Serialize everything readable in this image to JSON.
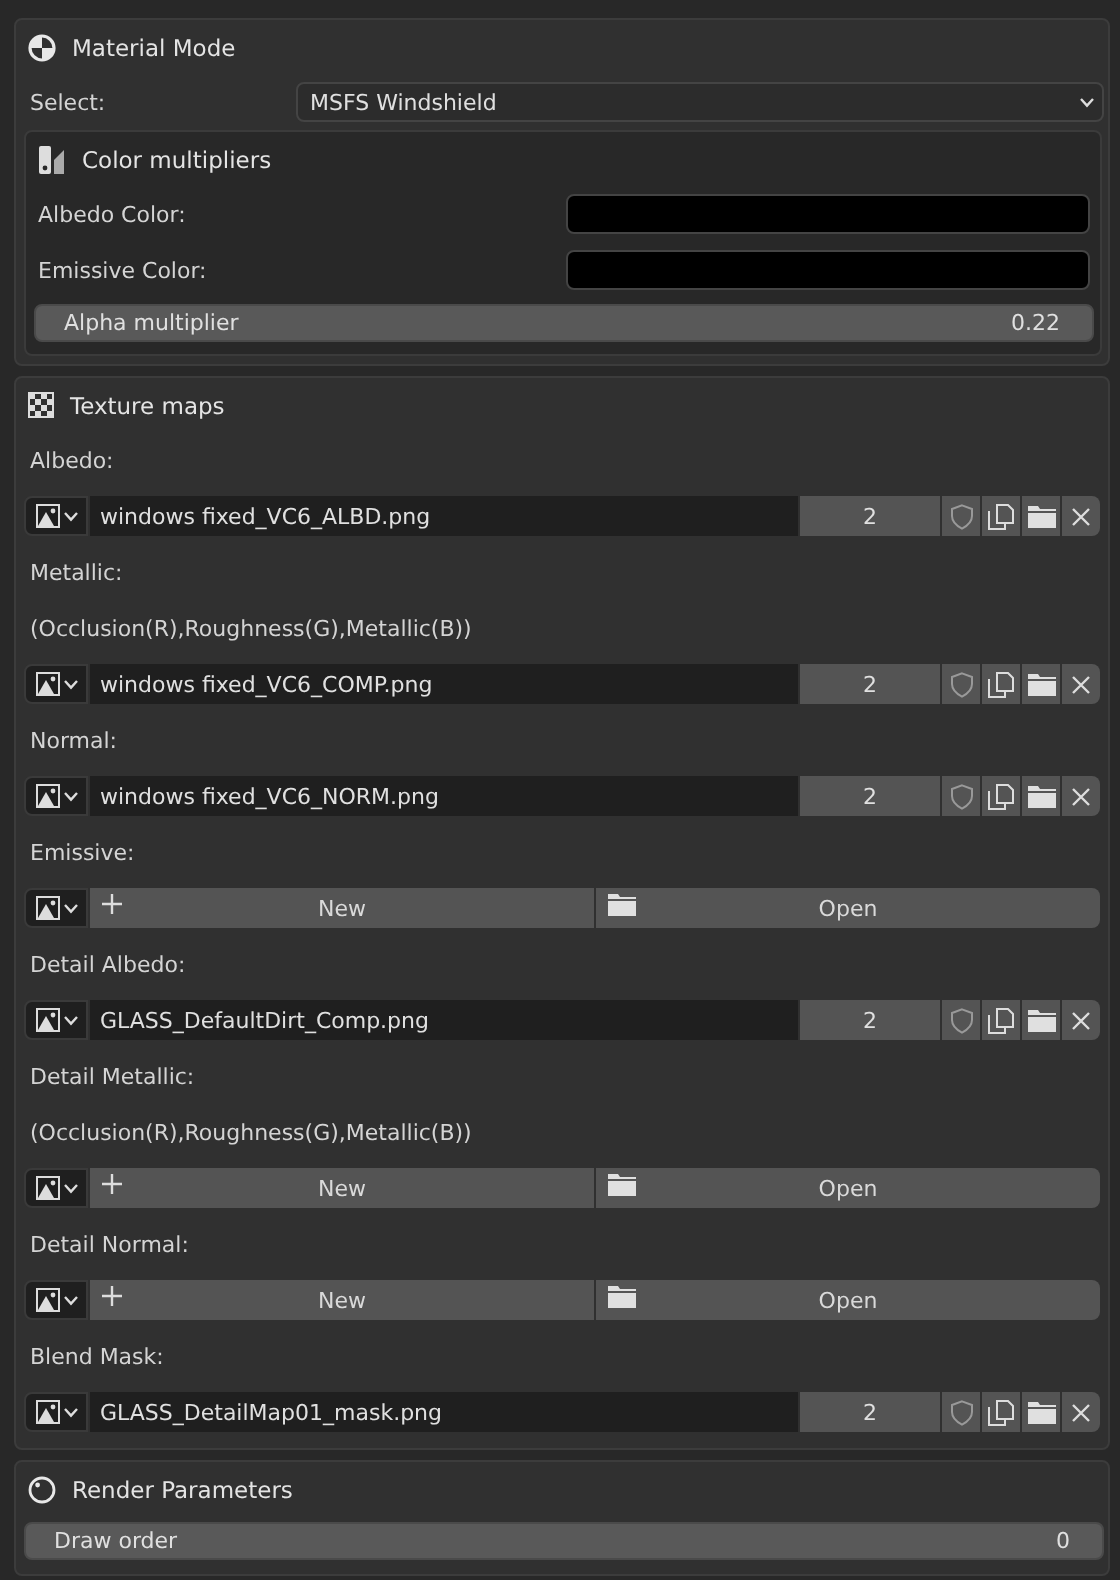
{
  "material_mode": {
    "title": "Material Mode",
    "select_label": "Select:",
    "select_value": "MSFS Windshield",
    "color_multipliers": {
      "title": "Color multipliers",
      "colors": [
        {
          "label": "Albedo Color:",
          "color": "#000000"
        },
        {
          "label": "Emissive Color:",
          "color": "#000000"
        }
      ],
      "alpha": {
        "label": "Alpha multiplier",
        "value": "0.22"
      }
    }
  },
  "texture_maps": {
    "title": "Texture maps",
    "items": [
      {
        "kind": "label",
        "text": "Albedo:"
      },
      {
        "kind": "file",
        "filename": "windows fixed_VC6_ALBD.png",
        "users": "2"
      },
      {
        "kind": "label",
        "text": "Metallic:"
      },
      {
        "kind": "label",
        "text": "(Occlusion(R),Roughness(G),Metallic(B))"
      },
      {
        "kind": "file",
        "filename": "windows fixed_VC6_COMP.png",
        "users": "2"
      },
      {
        "kind": "label",
        "text": "Normal:"
      },
      {
        "kind": "file",
        "filename": "windows fixed_VC6_NORM.png",
        "users": "2"
      },
      {
        "kind": "label",
        "text": "Emissive:"
      },
      {
        "kind": "empty",
        "new_label": "New",
        "open_label": "Open"
      },
      {
        "kind": "label",
        "text": "Detail Albedo:"
      },
      {
        "kind": "file",
        "filename": "GLASS_DefaultDirt_Comp.png",
        "users": "2"
      },
      {
        "kind": "label",
        "text": "Detail Metallic:"
      },
      {
        "kind": "label",
        "text": "(Occlusion(R),Roughness(G),Metallic(B))"
      },
      {
        "kind": "empty",
        "new_label": "New",
        "open_label": "Open"
      },
      {
        "kind": "label",
        "text": "Detail Normal:"
      },
      {
        "kind": "empty",
        "new_label": "New",
        "open_label": "Open"
      },
      {
        "kind": "label",
        "text": "Blend Mask:"
      },
      {
        "kind": "file",
        "filename": "GLASS_DetailMap01_mask.png",
        "users": "2"
      }
    ]
  },
  "render_parameters": {
    "title": "Render Parameters",
    "fields": [
      {
        "label": "Draw order",
        "value": "0"
      }
    ]
  }
}
